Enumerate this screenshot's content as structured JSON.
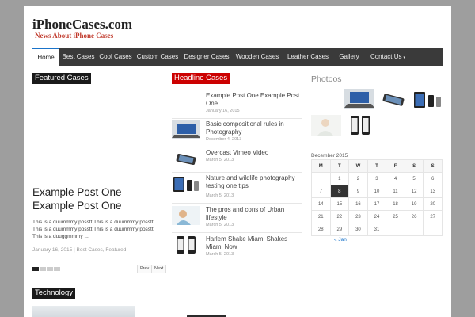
{
  "site": {
    "title": "iPhoneCases.com",
    "tagline": "News About iPhone Cases"
  },
  "nav": {
    "items": [
      "Home",
      "Best Cases",
      "Cool Cases",
      "Custom Cases",
      "Designer Cases",
      "Wooden Cases",
      "Leather Cases",
      "Gallery",
      "Contact Us"
    ],
    "contact_caret": "▾"
  },
  "featured": {
    "label": "Featured Cases",
    "title": "Example Post One Example Post One",
    "excerpt": "This is a duummmy posstt This is a duummmy posstt This is a duummmy posstt This is a duummmy posstt This is a duuggmmmy ...",
    "meta": "January 16, 2015 | Best Cases, Featured",
    "prev": "Prev",
    "next": "Next"
  },
  "headlines": {
    "label": "Headline Cases",
    "items": [
      {
        "title": "Example Post One Example Post One",
        "date": "January 16, 2015"
      },
      {
        "title": "Basic compositional rules in Photography",
        "date": "December 4, 2013"
      },
      {
        "title": "Overcast Vimeo Video",
        "date": "March 5, 2013"
      },
      {
        "title": "Nature and wildlife photography testing one tips",
        "date": "March 5, 2013"
      },
      {
        "title": "The pros and cons of Urban lifestyle",
        "date": "March 5, 2013"
      },
      {
        "title": "Harlem Shake Miami Shakes Miami Now",
        "date": "March 5, 2013"
      }
    ]
  },
  "photos": {
    "title": "Photoos"
  },
  "calendar": {
    "caption": "December 2015",
    "headers": [
      "M",
      "T",
      "W",
      "T",
      "F",
      "S",
      "S"
    ],
    "rows": [
      [
        "",
        "1",
        "2",
        "3",
        "4",
        "5",
        "6"
      ],
      [
        "7",
        "8",
        "9",
        "10",
        "11",
        "12",
        "13"
      ],
      [
        "14",
        "15",
        "16",
        "17",
        "18",
        "19",
        "20"
      ],
      [
        "21",
        "22",
        "23",
        "24",
        "25",
        "26",
        "27"
      ],
      [
        "28",
        "29",
        "30",
        "31",
        "",
        "",
        ""
      ]
    ],
    "today": "8",
    "prev_link": "« Jan"
  },
  "technology": {
    "label": "Technology"
  }
}
